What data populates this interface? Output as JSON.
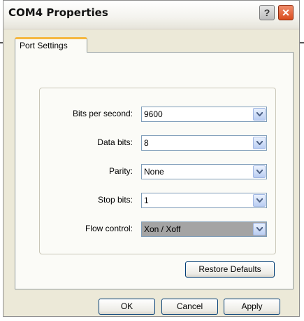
{
  "window": {
    "title": "COM4 Properties"
  },
  "title_buttons": {
    "help": "?",
    "close": "✕"
  },
  "tabs": [
    {
      "label": "Port Settings",
      "active": true
    }
  ],
  "fields": [
    {
      "label": "Bits per second:",
      "value": "9600"
    },
    {
      "label": "Data bits:",
      "value": "8"
    },
    {
      "label": "Parity:",
      "value": "None"
    },
    {
      "label": "Stop bits:",
      "value": "1"
    },
    {
      "label": "Flow control:",
      "value": "Xon / Xoff"
    }
  ],
  "buttons": {
    "restore_defaults": "Restore Defaults",
    "ok": "OK",
    "cancel": "Cancel",
    "apply": "Apply"
  }
}
